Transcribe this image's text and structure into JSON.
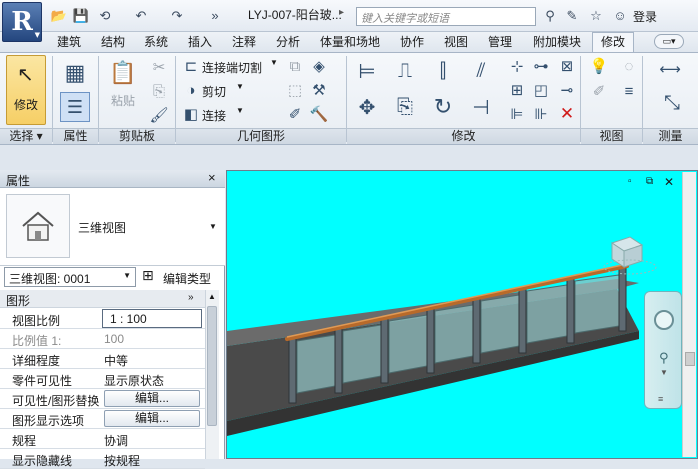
{
  "app": {
    "logo": "R",
    "doc_title": "LYJ-007-阳台玻...",
    "search_placeholder": "键入关键字或短语",
    "login_label": "登录"
  },
  "quick_access": {
    "icons": [
      "open-icon",
      "save-icon",
      "sync-icon",
      "undo-icon",
      "redo-icon",
      "more-icon"
    ]
  },
  "tabs": [
    "建筑",
    "结构",
    "系统",
    "插入",
    "注释",
    "分析",
    "体量和场地",
    "协作",
    "视图",
    "管理",
    "附加模块",
    "修改"
  ],
  "active_tab": "修改",
  "ribbon": {
    "modify_label": "修改",
    "paste_label": "粘贴",
    "join_cut_label": "连接端切割",
    "cut_label": "剪切",
    "join_label": "连接",
    "panels": {
      "select": "选择",
      "properties": "属性",
      "clipboard": "剪贴板",
      "geometry": "几何图形",
      "modify": "修改",
      "view": "视图",
      "measure": "测量"
    }
  },
  "properties_panel": {
    "title": "属性",
    "close": "×",
    "type_name": "三维视图",
    "view_selector": "三维视图: 0001",
    "edit_type_label": "编辑类型",
    "group": "图形",
    "rows": [
      {
        "key": "视图比例",
        "value": "1 : 100"
      },
      {
        "key": "比例值 1:",
        "value": "100"
      },
      {
        "key": "详细程度",
        "value": "中等"
      },
      {
        "key": "零件可见性",
        "value": "显示原状态"
      },
      {
        "key": "可见性/图形替换",
        "value": "编辑..."
      },
      {
        "key": "图形显示选项",
        "value": "编辑..."
      },
      {
        "key": "规程",
        "value": "协调"
      },
      {
        "key": "显示隐藏线",
        "value": "按规程"
      }
    ]
  },
  "viewport": {
    "background": "#00ffff",
    "controls": [
      "minimize-icon",
      "restore-icon",
      "close-icon"
    ]
  }
}
